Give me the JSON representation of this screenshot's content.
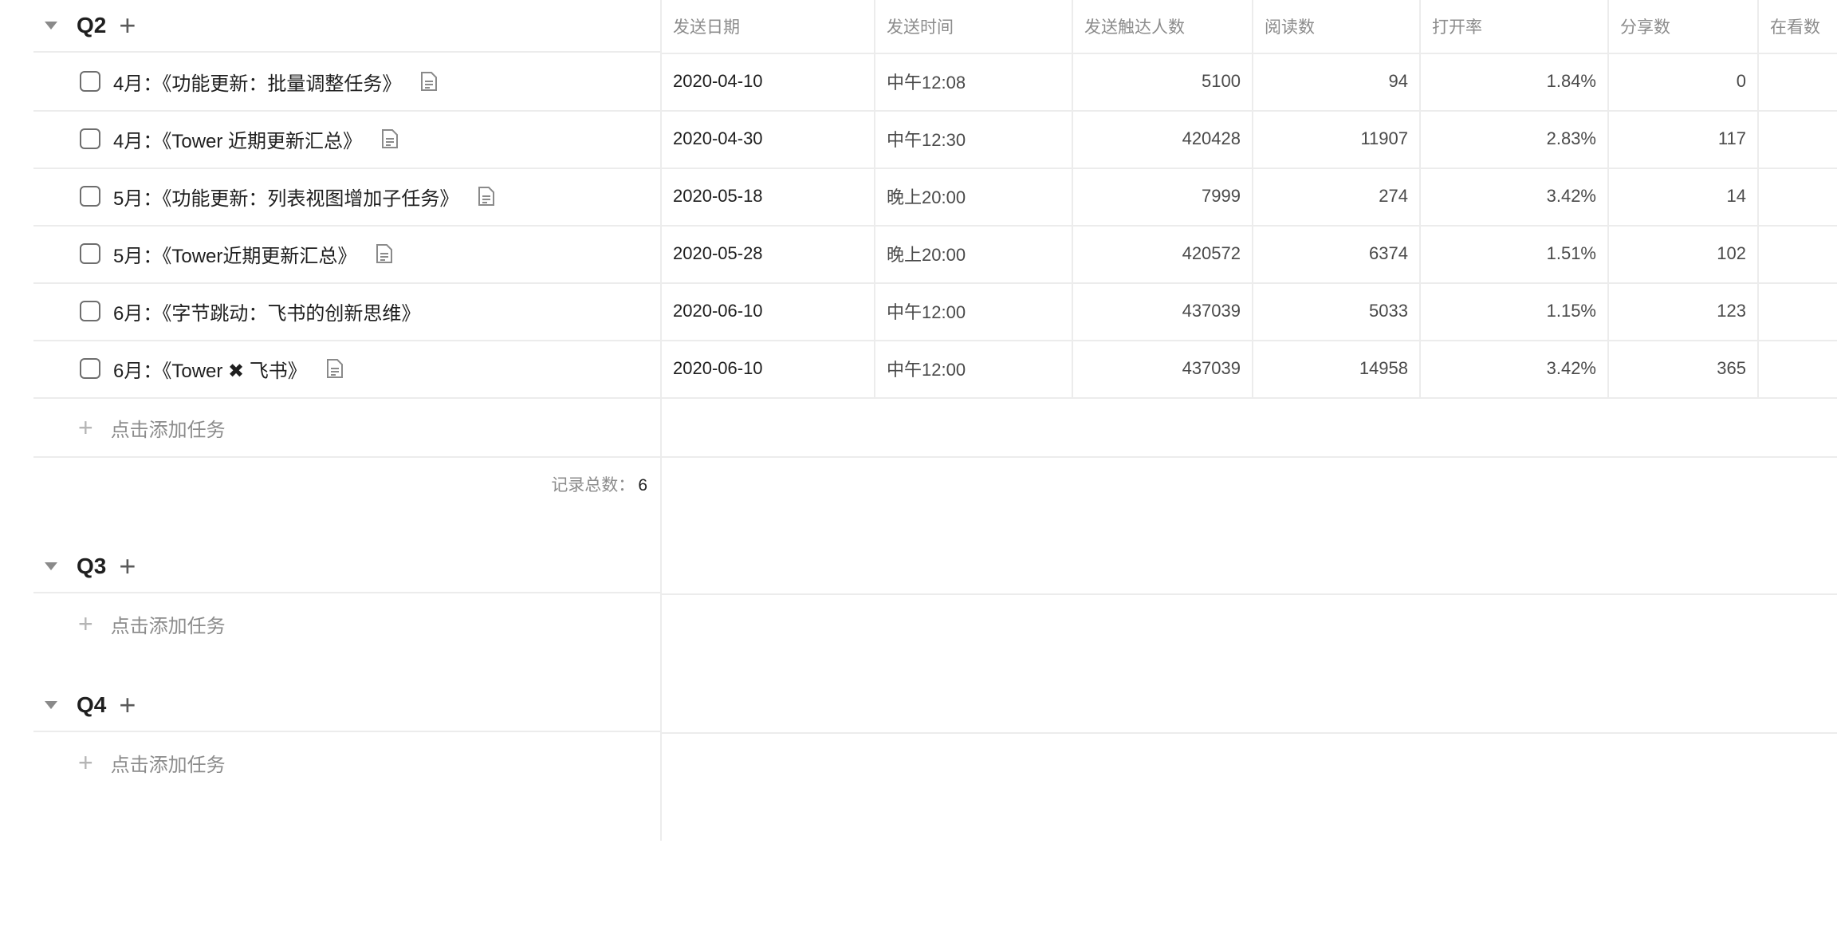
{
  "columns": [
    "发送日期",
    "发送时间",
    "发送触达人数",
    "阅读数",
    "打开率",
    "分享数",
    "在看数"
  ],
  "groups": [
    {
      "title": "Q2",
      "add_label": "点击添加任务",
      "record_label": "记录总数：",
      "record_count": "6",
      "tasks": [
        {
          "title": "4月：《功能更新：批量调整任务》",
          "has_doc": true,
          "date": "2020-04-10",
          "time": "中午12:08",
          "reach": "5100",
          "reads": "94",
          "open_rate": "1.84%",
          "shares": "0",
          "watching": ""
        },
        {
          "title": "4月：《Tower 近期更新汇总》",
          "has_doc": true,
          "date": "2020-04-30",
          "time": "中午12:30",
          "reach": "420428",
          "reads": "11907",
          "open_rate": "2.83%",
          "shares": "117",
          "watching": ""
        },
        {
          "title": "5月：《功能更新：列表视图增加子任务》",
          "has_doc": true,
          "date": "2020-05-18",
          "time": "晚上20:00",
          "reach": "7999",
          "reads": "274",
          "open_rate": "3.42%",
          "shares": "14",
          "watching": ""
        },
        {
          "title": "5月：《Tower近期更新汇总》",
          "has_doc": true,
          "date": "2020-05-28",
          "time": "晚上20:00",
          "reach": "420572",
          "reads": "6374",
          "open_rate": "1.51%",
          "shares": "102",
          "watching": ""
        },
        {
          "title": "6月：《字节跳动：飞书的创新思维》",
          "has_doc": false,
          "date": "2020-06-10",
          "time": "中午12:00",
          "reach": "437039",
          "reads": "5033",
          "open_rate": "1.15%",
          "shares": "123",
          "watching": ""
        },
        {
          "title": "6月：《Tower ✖ 飞书》",
          "has_doc": true,
          "date": "2020-06-10",
          "time": "中午12:00",
          "reach": "437039",
          "reads": "14958",
          "open_rate": "3.42%",
          "shares": "365",
          "watching": ""
        }
      ]
    },
    {
      "title": "Q3",
      "add_label": "点击添加任务",
      "tasks": []
    },
    {
      "title": "Q4",
      "add_label": "点击添加任务",
      "tasks": []
    }
  ]
}
